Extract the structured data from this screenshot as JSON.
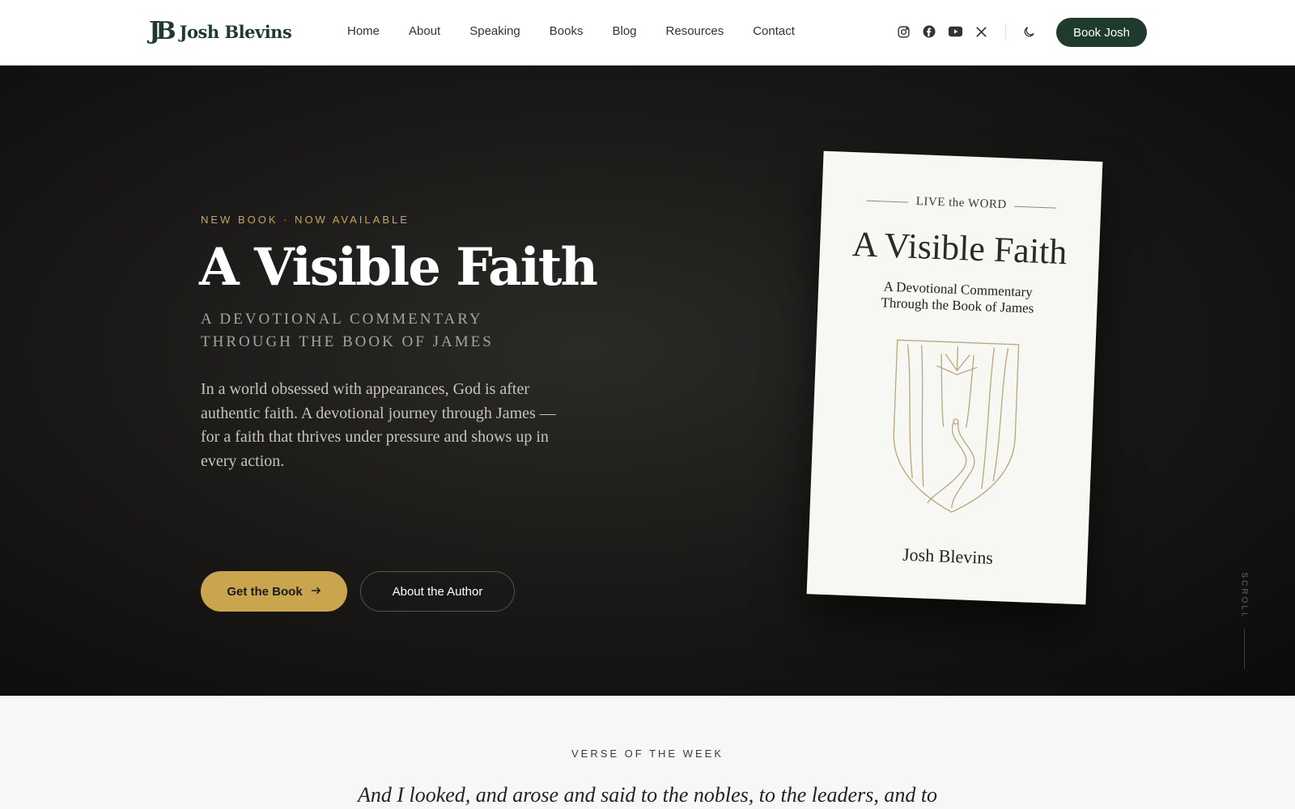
{
  "brand": {
    "logo_mark": "JB",
    "name": "Josh Blevins"
  },
  "nav": {
    "items": [
      {
        "label": "Home"
      },
      {
        "label": "About"
      },
      {
        "label": "Speaking"
      },
      {
        "label": "Books"
      },
      {
        "label": "Blog"
      },
      {
        "label": "Resources"
      },
      {
        "label": "Contact"
      }
    ]
  },
  "social_icons": [
    "instagram-icon",
    "facebook-icon",
    "youtube-icon",
    "x-icon"
  ],
  "header": {
    "cta_label": "Book Josh",
    "theme_icon": "moon-icon"
  },
  "colors": {
    "accent_gold": "#c9a64d",
    "brand_green": "#1e3b2e",
    "hero_bg": "#141412"
  },
  "hero": {
    "eyebrow": "NEW BOOK · NOW AVAILABLE",
    "title": "A Visible Faith",
    "subtitle_line1": "A DEVOTIONAL COMMENTARY",
    "subtitle_line2": "THROUGH THE BOOK OF JAMES",
    "description": "In a world obsessed with appearances, God is after authentic faith. A devotional journey through James — for a faith that thrives under pressure and shows up in every action.",
    "primary_cta": "Get the Book",
    "secondary_cta": "About the Author"
  },
  "book_cover": {
    "series": "LIVE the WORD",
    "title": "A Visible Faith",
    "subtitle_line1": "A Devotional Commentary",
    "subtitle_line2": "Through the Book of James",
    "author": "Josh Blevins"
  },
  "scroll_label": "SCROLL",
  "verse": {
    "label": "VERSE OF THE WEEK",
    "text": "And I looked, and arose and said to the nobles, to the leaders, and to"
  }
}
